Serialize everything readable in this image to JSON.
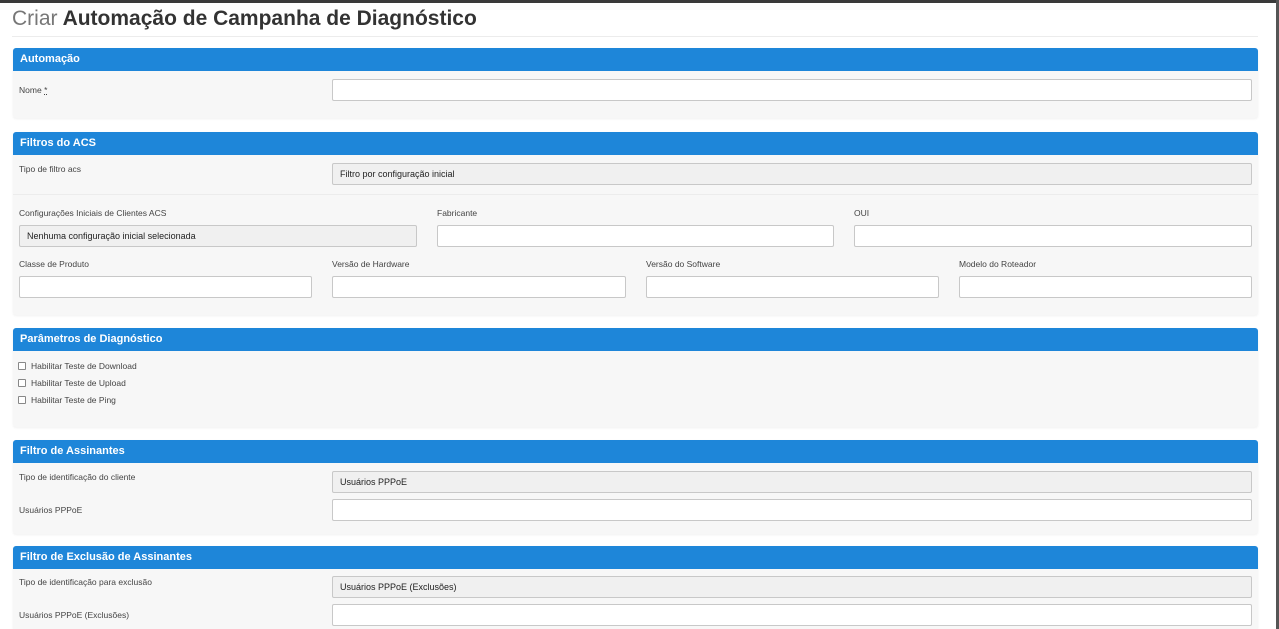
{
  "page": {
    "title_prefix": "Criar",
    "title_main": "Automação de Campanha de Diagnóstico"
  },
  "automation": {
    "header": "Automação",
    "name_label": "Nome",
    "required_mark": "*",
    "name_value": ""
  },
  "acs_filters": {
    "header": "Filtros do ACS",
    "filter_type_label": "Tipo de filtro acs",
    "filter_type_value": "Filtro por configuração inicial",
    "initial_configs_label": "Configurações Iniciais de Clientes ACS",
    "initial_configs_value": "Nenhuma configuração inicial selecionada",
    "manufacturer_label": "Fabricante",
    "manufacturer_value": "",
    "oui_label": "OUI",
    "oui_value": "",
    "product_class_label": "Classe de Produto",
    "product_class_value": "",
    "hardware_version_label": "Versão de Hardware",
    "hardware_version_value": "",
    "software_version_label": "Versão do Software",
    "software_version_value": "",
    "router_model_label": "Modelo do Roteador",
    "router_model_value": ""
  },
  "diagnostics": {
    "header": "Parâmetros de Diagnóstico",
    "options": [
      {
        "label": "Habilitar Teste de Download",
        "checked": false
      },
      {
        "label": "Habilitar Teste de Upload",
        "checked": false
      },
      {
        "label": "Habilitar Teste de Ping",
        "checked": false
      }
    ]
  },
  "subscriber_filter": {
    "header": "Filtro de Assinantes",
    "id_type_label": "Tipo de identificação do cliente",
    "id_type_value": "Usuários PPPoE",
    "pppoe_users_label": "Usuários PPPoE",
    "pppoe_users_value": ""
  },
  "subscriber_exclusion": {
    "header": "Filtro de Exclusão de Assinantes",
    "id_type_label": "Tipo de identificação para exclusão",
    "id_type_value": "Usuários PPPoE (Exclusões)",
    "pppoe_users_label": "Usuários PPPoE (Exclusões)",
    "pppoe_users_value": ""
  },
  "colors": {
    "panel_header": "#1e86d9",
    "panel_body": "#f7f7f7",
    "readonly_field": "#f0f0f0"
  }
}
